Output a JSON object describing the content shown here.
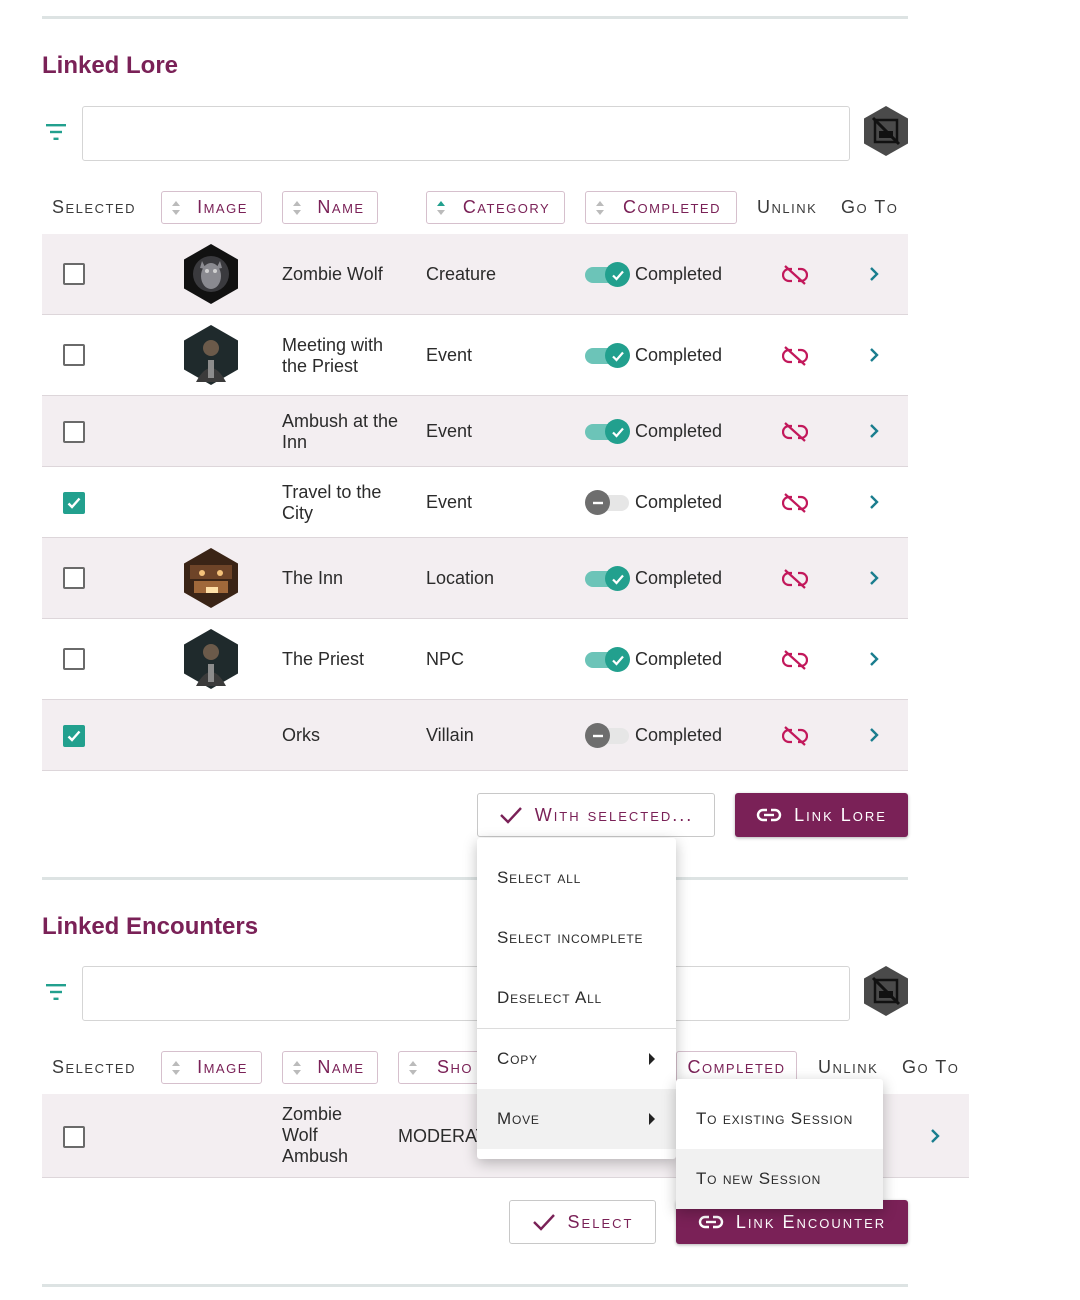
{
  "linked_lore": {
    "title": "Linked Lore",
    "columns": {
      "selected": "Selected",
      "image": "Image",
      "name": "Name",
      "category": "Category",
      "completed": "Completed",
      "unlink": "Unlink",
      "goto": "Go To"
    },
    "rows": [
      {
        "selected": false,
        "image": "zombie-wolf-portrait",
        "name": "Zombie Wolf",
        "category": "Creature",
        "completed": true,
        "completed_label": "Completed"
      },
      {
        "selected": false,
        "image": "priest-portrait",
        "name": "Meeting with the Priest",
        "category": "Event",
        "completed": true,
        "completed_label": "Completed"
      },
      {
        "selected": false,
        "image": "",
        "name": "Ambush at the Inn",
        "category": "Event",
        "completed": true,
        "completed_label": "Completed"
      },
      {
        "selected": true,
        "image": "",
        "name": "Travel to the City",
        "category": "Event",
        "completed": false,
        "completed_label": "Completed"
      },
      {
        "selected": false,
        "image": "inn-interior-portrait",
        "name": "The Inn",
        "category": "Location",
        "completed": true,
        "completed_label": "Completed"
      },
      {
        "selected": false,
        "image": "priest-portrait",
        "name": "The Priest",
        "category": "NPC",
        "completed": true,
        "completed_label": "Completed"
      },
      {
        "selected": true,
        "image": "",
        "name": "Orks",
        "category": "Villain",
        "completed": false,
        "completed_label": "Completed"
      }
    ],
    "with_selected_label": "With selected...",
    "link_button_label": "Link Lore"
  },
  "menu": {
    "items": [
      "Select all",
      "Select incomplete",
      "Deselect All",
      "Copy",
      "Move"
    ],
    "submenu": [
      "To existing Session",
      "To new Session"
    ]
  },
  "linked_encounters": {
    "title": "Linked Encounters",
    "columns": {
      "selected": "Selected",
      "image": "Image",
      "name": "Name",
      "short": "Sho",
      "completed": "Completed",
      "unlink": "Unlink",
      "goto": "Go To"
    },
    "rows": [
      {
        "selected": false,
        "name": "Zombie Wolf Ambush",
        "difficulty": "MODERAT"
      }
    ],
    "select_label": "Select",
    "link_button_label": "Link Encounter"
  },
  "colors": {
    "accent": "#7a2157",
    "teal": "#22a08e",
    "row_shade": "#f3eef1"
  }
}
